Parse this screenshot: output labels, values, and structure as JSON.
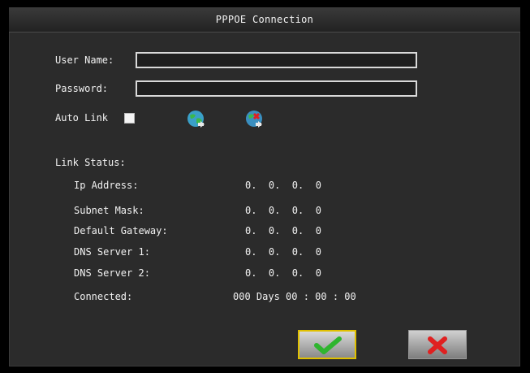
{
  "dialog": {
    "title": "PPPOE Connection"
  },
  "form": {
    "user_name_label": "User Name:",
    "user_name_value": "",
    "password_label": "Password:",
    "password_value": "",
    "auto_link_label": "Auto Link",
    "auto_link_checked": true
  },
  "status": {
    "header": "Link Status:",
    "rows": [
      {
        "label": "Ip Address:",
        "value": "0.  0.  0.  0"
      },
      {
        "label": "Subnet Mask:",
        "value": "0.  0.  0.  0"
      },
      {
        "label": "Default Gateway:",
        "value": "0.  0.  0.  0"
      },
      {
        "label": "DNS Server 1:",
        "value": "0.  0.  0.  0"
      },
      {
        "label": "DNS Server 2:",
        "value": "0.  0.  0.  0"
      }
    ],
    "connected_label": "Connected:",
    "connected_value": "000 Days 00 : 00 : 00"
  },
  "icons": {
    "connect": "globe-connect-icon",
    "disconnect": "globe-disconnect-icon",
    "ok": "green-checkmark-icon",
    "cancel": "red-x-icon"
  },
  "colors": {
    "background": "#2b2b2b",
    "text": "#f2f2f2",
    "ok_border": "#e0c000",
    "check_green": "#2fb52f",
    "cancel_red": "#e02020"
  }
}
